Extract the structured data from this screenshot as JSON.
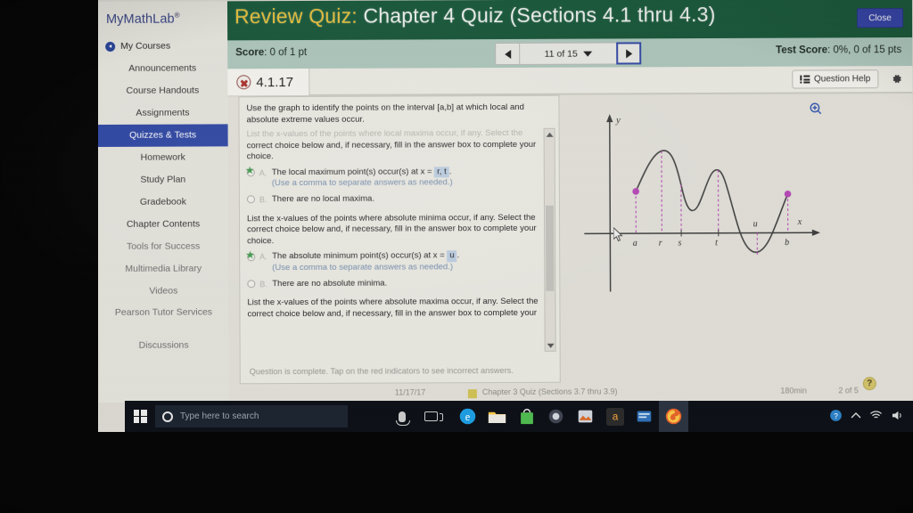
{
  "sidebar": {
    "brand": "MyMathLab",
    "brand_sup": "®",
    "items": [
      {
        "label": "My Courses",
        "state": "back"
      },
      {
        "label": "Announcements",
        "state": "normal"
      },
      {
        "label": "Course Handouts",
        "state": "normal"
      },
      {
        "label": "Assignments",
        "state": "normal"
      },
      {
        "label": "Quizzes & Tests",
        "state": "active"
      },
      {
        "label": "Homework",
        "state": "normal"
      },
      {
        "label": "Study Plan",
        "state": "normal"
      },
      {
        "label": "Gradebook",
        "state": "normal"
      },
      {
        "label": "Chapter Contents",
        "state": "normal"
      },
      {
        "label": "Tools for Success",
        "state": "dim"
      },
      {
        "label": "Multimedia Library",
        "state": "dim"
      },
      {
        "label": "Videos",
        "state": "dim"
      },
      {
        "label": "Pearson Tutor Services",
        "state": "dim"
      },
      {
        "label": "Discussions",
        "state": "dim"
      }
    ]
  },
  "header": {
    "title_lead": "Review Quiz:",
    "title_rest": "Chapter 4 Quiz (Sections 4.1 thru 4.3)",
    "close_label": "Close"
  },
  "scorebar": {
    "score_label": "Score",
    "score_value": ": 0 of 1 pt",
    "page_indicator": "11 of 15",
    "test_score_label": "Test Score",
    "test_score_value": ": 0%, 0 of 15 pts",
    "prev_icon": "triangle-left-icon",
    "next_icon": "triangle-right-icon",
    "dropdown_icon": "caret-down-icon"
  },
  "question_header": {
    "number": "4.1.17",
    "status_icon": "red-x-incorrect-icon",
    "help_label": "Question Help",
    "help_icon": "list-icon",
    "settings_icon": "gear-icon"
  },
  "question": {
    "prompt": "Use the graph to identify the points on the interval [a,b] at which local and absolute extreme values occur.",
    "parts": [
      {
        "instruction_clipped": "List the x-values of the points where local maxima occur, if any. Select the",
        "instruction": "correct choice below and, if necessary, fill in the answer box to complete your choice.",
        "choices": [
          {
            "label": "A.",
            "text_before": "The local maximum point(s) occur(s) at x =",
            "answer": "r, t",
            "text_after": ".",
            "marked": true,
            "hint": "(Use a comma to separate answers as needed.)"
          },
          {
            "label": "B.",
            "text_before": "There are no local maxima.",
            "answer": "",
            "text_after": "",
            "marked": false,
            "hint": ""
          }
        ]
      },
      {
        "instruction_clipped": "",
        "instruction": "List the x-values of the points where absolute minima occur, if any. Select the correct choice below and, if necessary, fill in the answer box to complete your choice.",
        "choices": [
          {
            "label": "A.",
            "text_before": "The absolute minimum point(s) occur(s) at x =",
            "answer": "u",
            "text_after": ".",
            "marked": true,
            "hint": "(Use a comma to separate answers as needed.)"
          },
          {
            "label": "B.",
            "text_before": "There are no absolute minima.",
            "answer": "",
            "text_after": "",
            "marked": false,
            "hint": ""
          }
        ]
      },
      {
        "instruction_clipped": "",
        "instruction": "List the x-values of the points where absolute maxima occur, if any. Select the correct choice below and, if necessary, fill in the answer box to complete your",
        "choices": []
      }
    ],
    "status": "Question is complete.  Tap on the red indicators to see incorrect answers."
  },
  "graph": {
    "zoom_icon": "magnifier-plus-icon",
    "x_axis_label": "x",
    "y_axis_label": "y",
    "tick_labels": [
      "a",
      "r",
      "s",
      "t",
      "u",
      "b"
    ],
    "endpoint_color": "#c83cc8",
    "dashed_color": "#c83cc8",
    "curve_color": "#3a3a3a"
  },
  "footer": {
    "help_badge": "?",
    "prev_icon": "triangle-left-icon",
    "next_icon": "triangle-right-icon"
  },
  "bottom_strip": {
    "date": "11/17/17",
    "assignment": "Chapter 3 Quiz (Sections 3.7 thru 3.9)",
    "duration": "180min",
    "progress": "2 of 5"
  },
  "taskbar": {
    "start_icon": "windows-logo-icon",
    "search_placeholder": "Type here to search",
    "search_icon": "cortana-circle-icon",
    "mic_icon": "microphone-icon",
    "taskview_icon": "task-view-icon",
    "apps": [
      {
        "name": "edge-icon",
        "glyph": "e",
        "color": "#1e9ce0"
      },
      {
        "name": "file-explorer-icon",
        "glyph": "",
        "color": "#f5c445"
      },
      {
        "name": "microsoft-store-icon",
        "glyph": "",
        "color": "#4fb84f"
      },
      {
        "name": "app-dark-icon",
        "glyph": "",
        "color": "#4a4a4a"
      },
      {
        "name": "photos-icon",
        "glyph": "",
        "color": "#d86a2a"
      },
      {
        "name": "amazon-icon",
        "glyph": "a",
        "color": "#f0a33c"
      },
      {
        "name": "app-blue-icon",
        "glyph": "",
        "color": "#2f6fb5"
      },
      {
        "name": "firefox-icon",
        "glyph": "",
        "color": "#e2622a"
      }
    ],
    "tray": {
      "chevron_icon": "chevron-up-icon",
      "network_icon": "wifi-icon",
      "volume_icon": "speaker-icon",
      "status_icon": "help-circle-icon"
    }
  }
}
